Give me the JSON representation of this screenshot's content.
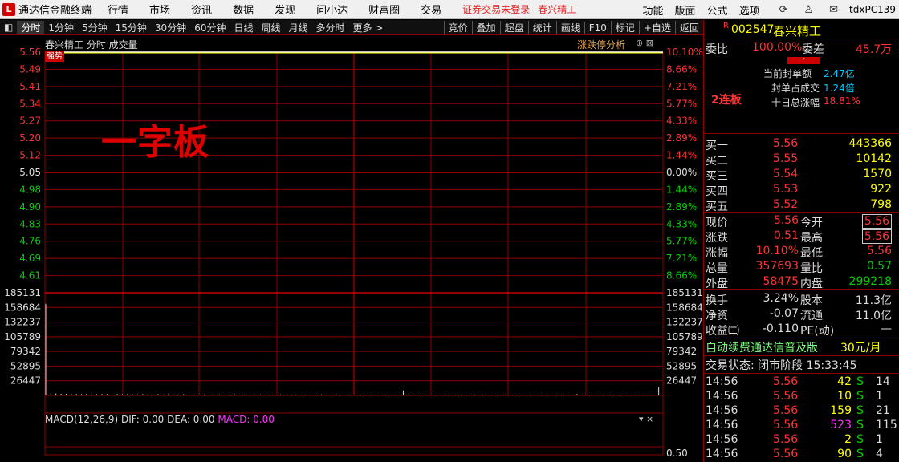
{
  "menubar": {
    "logo": "L",
    "app_title": "通达信金融终端",
    "items": [
      "行情",
      "市场",
      "资讯",
      "数据",
      "发现",
      "问小达",
      "财富圈",
      "交易"
    ],
    "notice": "证券交易未登录",
    "stock": "春兴精工",
    "right_items": [
      "功能",
      "版面",
      "公式",
      "选项"
    ],
    "pc_label": "tdxPC139"
  },
  "toolbar": {
    "left": [
      "分时",
      "1分钟",
      "5分钟",
      "15分钟",
      "30分钟",
      "60分钟",
      "日线",
      "周线",
      "月线",
      "多分时",
      "更多 >"
    ],
    "right": [
      "竞价",
      "叠加",
      "超盘",
      "统计",
      "画线",
      "F10",
      "标记",
      "+自选",
      "返回"
    ]
  },
  "chart": {
    "head": "春兴精工  分时  成交量",
    "zt_label": "涨跌停分析",
    "head_icons": "⊕ ⊠",
    "strong_tag": "强势",
    "overlay_text": "一字板",
    "price_labels": [
      "5.56",
      "5.49",
      "5.41",
      "5.34",
      "5.27",
      "5.20",
      "5.12",
      "5.05",
      "4.98",
      "4.90",
      "4.83",
      "4.76",
      "4.69",
      "4.61"
    ],
    "pct_labels": [
      "10.10%",
      "8.66%",
      "7.21%",
      "5.77%",
      "4.33%",
      "2.89%",
      "1.44%",
      "0.00%",
      "1.44%",
      "2.89%",
      "4.33%",
      "5.77%",
      "7.21%",
      "8.66%"
    ],
    "vol_labels": [
      "185131",
      "158684",
      "132237",
      "105789",
      "79342",
      "52895",
      "26447"
    ],
    "macd_title": "MACD(12,26,9)",
    "dif": "DIF: 0.00",
    "dea": "DEA: 0.00",
    "macd": "MACD: 0.00",
    "macd_ctrl": "▾ ×",
    "macd_right": "0.50"
  },
  "chart_data": {
    "type": "line",
    "title": "春兴精工 分时",
    "price_series": {
      "name": "春兴精工",
      "value": 5.56,
      "prev_close": 5.05,
      "ylim": [
        4.61,
        5.56
      ]
    },
    "volume_ylim": [
      0,
      185131
    ],
    "volume": [
      165000,
      4000,
      3500,
      3000,
      2800,
      3200,
      2600,
      2400,
      3000,
      2500,
      2200,
      2800,
      2300,
      2000,
      2600,
      2100,
      2400,
      2000,
      1900,
      2300,
      2100,
      1800,
      2200,
      1700,
      2000,
      1900,
      1600,
      2100,
      1800,
      1500,
      1900,
      1700,
      2000,
      1600,
      1800,
      1500,
      1700,
      1900,
      1400,
      1600,
      1800,
      1500,
      1700,
      1300,
      1600,
      1400,
      1800,
      1500,
      1200,
      1700,
      1400,
      1600,
      1300,
      1500,
      1800,
      1400,
      1200,
      1600,
      1300,
      1500,
      1400,
      1100,
      1500,
      1300,
      1600,
      1200,
      1400,
      1700,
      1300,
      1100,
      9000,
      1500,
      1400,
      1200,
      1600,
      1300,
      1500,
      1100,
      1400,
      1300,
      1200,
      1500,
      1000,
      1300,
      1600,
      1200,
      1400,
      1100,
      1300,
      1500,
      1200,
      1400,
      1000,
      1300,
      1100,
      1400,
      1200,
      1500,
      1300,
      1100,
      1200,
      1400,
      1300,
      1000,
      2500,
      1200,
      1400,
      1100,
      1300,
      1500,
      1200,
      1400,
      1100,
      1300,
      1200,
      1600,
      1300,
      1100,
      1400,
      1200,
      15000
    ]
  },
  "panel": {
    "code_badge": "R",
    "code": "002547",
    "name": "春兴精工",
    "wb_label": "委比",
    "wb_value": "100.00%",
    "wc_label": "委差",
    "wc_value": "45.7万",
    "seal_label": "当前封单额",
    "seal_value": "2.47亿",
    "ratio_label": "封单占成交",
    "ratio_value": "1.24倍",
    "ten_label": "十日总涨幅",
    "ten_value": "18.81%",
    "board": "2连板",
    "bids": [
      {
        "label": "买一",
        "price": "5.56",
        "vol": "443366"
      },
      {
        "label": "买二",
        "price": "5.55",
        "vol": "10142"
      },
      {
        "label": "买三",
        "price": "5.54",
        "vol": "1570"
      },
      {
        "label": "买四",
        "price": "5.53",
        "vol": "922"
      },
      {
        "label": "买五",
        "price": "5.52",
        "vol": "798"
      }
    ],
    "q": [
      {
        "l1": "现价",
        "v1": "5.56",
        "l2": "今开",
        "v2": "5.56"
      },
      {
        "l1": "涨跌",
        "v1": "0.51",
        "l2": "最高",
        "v2": "5.56"
      },
      {
        "l1": "涨幅",
        "v1": "10.10%",
        "l2": "最低",
        "v2": "5.56"
      },
      {
        "l1": "总量",
        "v1": "357693",
        "l2": "量比",
        "v2": "0.57"
      },
      {
        "l1": "外盘",
        "v1": "58475",
        "l2": "内盘",
        "v2": "299218"
      }
    ],
    "f": [
      {
        "l1": "换手",
        "v1": "3.24%",
        "l2": "股本",
        "v2": "11.3亿"
      },
      {
        "l1": "净资",
        "v1": "-0.07",
        "l2": "流通",
        "v2": "11.0亿"
      },
      {
        "l1": "收益㈢",
        "v1": "-0.110",
        "l2": "PE(动)",
        "v2": "—"
      }
    ],
    "ad_text": "自动续费通达信普及版",
    "ad_price": "30元/月",
    "trade_state": "交易状态: 闭市阶段 15:33:45",
    "ticks": [
      {
        "time": "14:56",
        "price": "5.56",
        "vol": "42",
        "dir": "S",
        "n": "14"
      },
      {
        "time": "14:56",
        "price": "5.56",
        "vol": "10",
        "dir": "S",
        "n": "1"
      },
      {
        "time": "14:56",
        "price": "5.56",
        "vol": "159",
        "dir": "S",
        "n": "21"
      },
      {
        "time": "14:56",
        "price": "5.56",
        "vol": "523",
        "dir": "S",
        "n": "115"
      },
      {
        "time": "14:56",
        "price": "5.56",
        "vol": "2",
        "dir": "S",
        "n": "1"
      },
      {
        "time": "14:56",
        "price": "5.56",
        "vol": "90",
        "dir": "S",
        "n": "4"
      }
    ]
  }
}
